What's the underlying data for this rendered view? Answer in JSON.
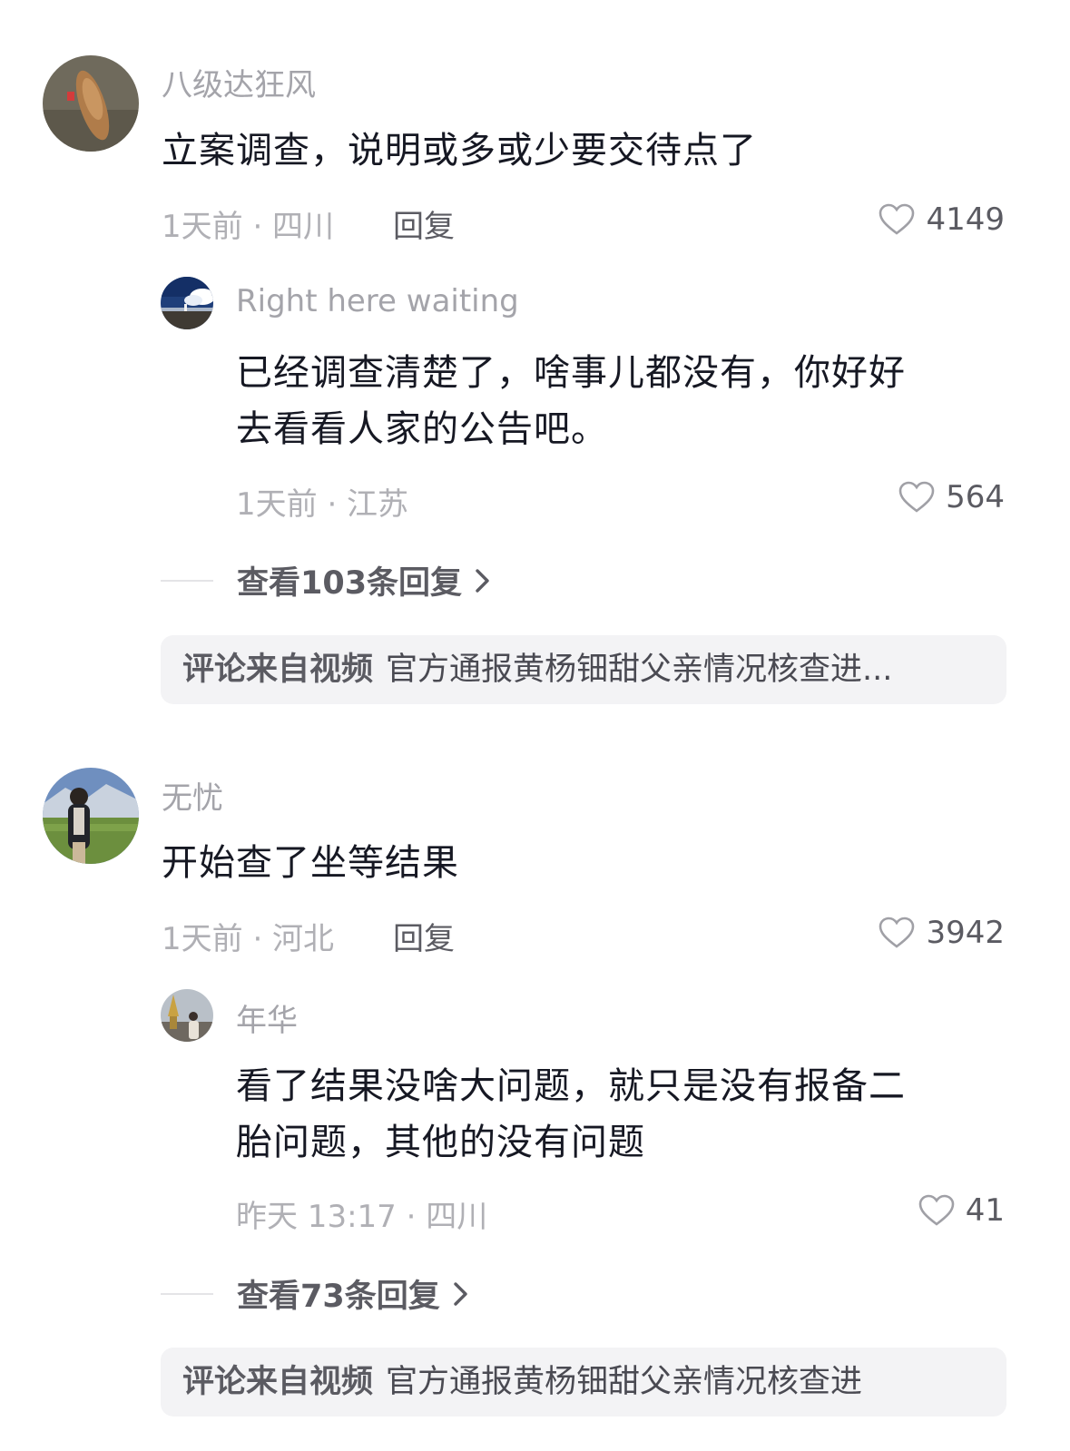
{
  "comments": [
    {
      "author": "八级达狂风",
      "text": "立案调查，说明或多或少要交待点了",
      "meta": "1天前 · 四川",
      "reply_label": "回复",
      "likes": "4149",
      "reply": {
        "author": "Right here waiting",
        "text_line1": "已经调查清楚了，啥事儿都没有，你好好",
        "text_line2": "去看看人家的公告吧。",
        "meta": "1天前 · 江苏",
        "likes": "564"
      },
      "view_more": "查看103条回复",
      "source_label": "评论来自视频",
      "source_title": "官方通报黄杨钿甜父亲情况核查进..."
    },
    {
      "author": "无忧",
      "text": "开始查了坐等结果",
      "meta": "1天前 · 河北",
      "reply_label": "回复",
      "likes": "3942",
      "reply": {
        "author": "年华",
        "text_line1": "看了结果没啥大问题，就只是没有报备二",
        "text_line2": "胎问题，其他的没有问题",
        "meta": "昨天 13:17 · 四川",
        "likes": "41"
      },
      "view_more": "查看73条回复",
      "source_label": "评论来自视频",
      "source_title": "官方通报黄杨钿甜父亲情况核查进"
    }
  ],
  "icons": {
    "like": "heart-outline-icon",
    "chevron": "chevron-right-icon"
  },
  "colors": {
    "primary_text": "#161823",
    "secondary_text": "#a4a4aa",
    "action_text": "#5b5b62",
    "source_bg": "#f3f3f5"
  }
}
